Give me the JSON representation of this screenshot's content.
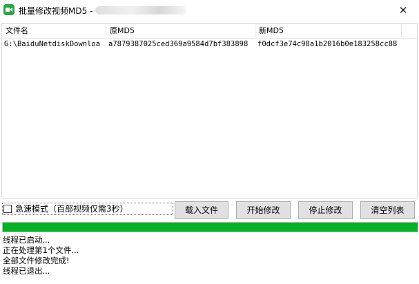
{
  "window": {
    "title": "批量修改视频MD5 - ",
    "close_glyph": "✕"
  },
  "table": {
    "columns": [
      "文件名",
      "原MD5",
      "新MD5"
    ],
    "rows": [
      [
        "G:\\BaiduNetdiskDownloa",
        "a7879387025ced369a9584d7bf383898",
        "f0dcf3e74c98a1b2016b0e183258cc88"
      ]
    ]
  },
  "options": {
    "fast_mode_label": "急速模式（百部视频仅需3秒）",
    "fast_mode_checked": false
  },
  "buttons": {
    "load": "载入文件",
    "start": "开始修改",
    "stop": "停止修改",
    "clear": "清空列表"
  },
  "progress": {
    "value": 1.0,
    "color": "#06b025"
  },
  "log": [
    "线程已启动...",
    "正在处理第1个文件...",
    "全部文件修改完成!",
    "线程已退出..."
  ]
}
